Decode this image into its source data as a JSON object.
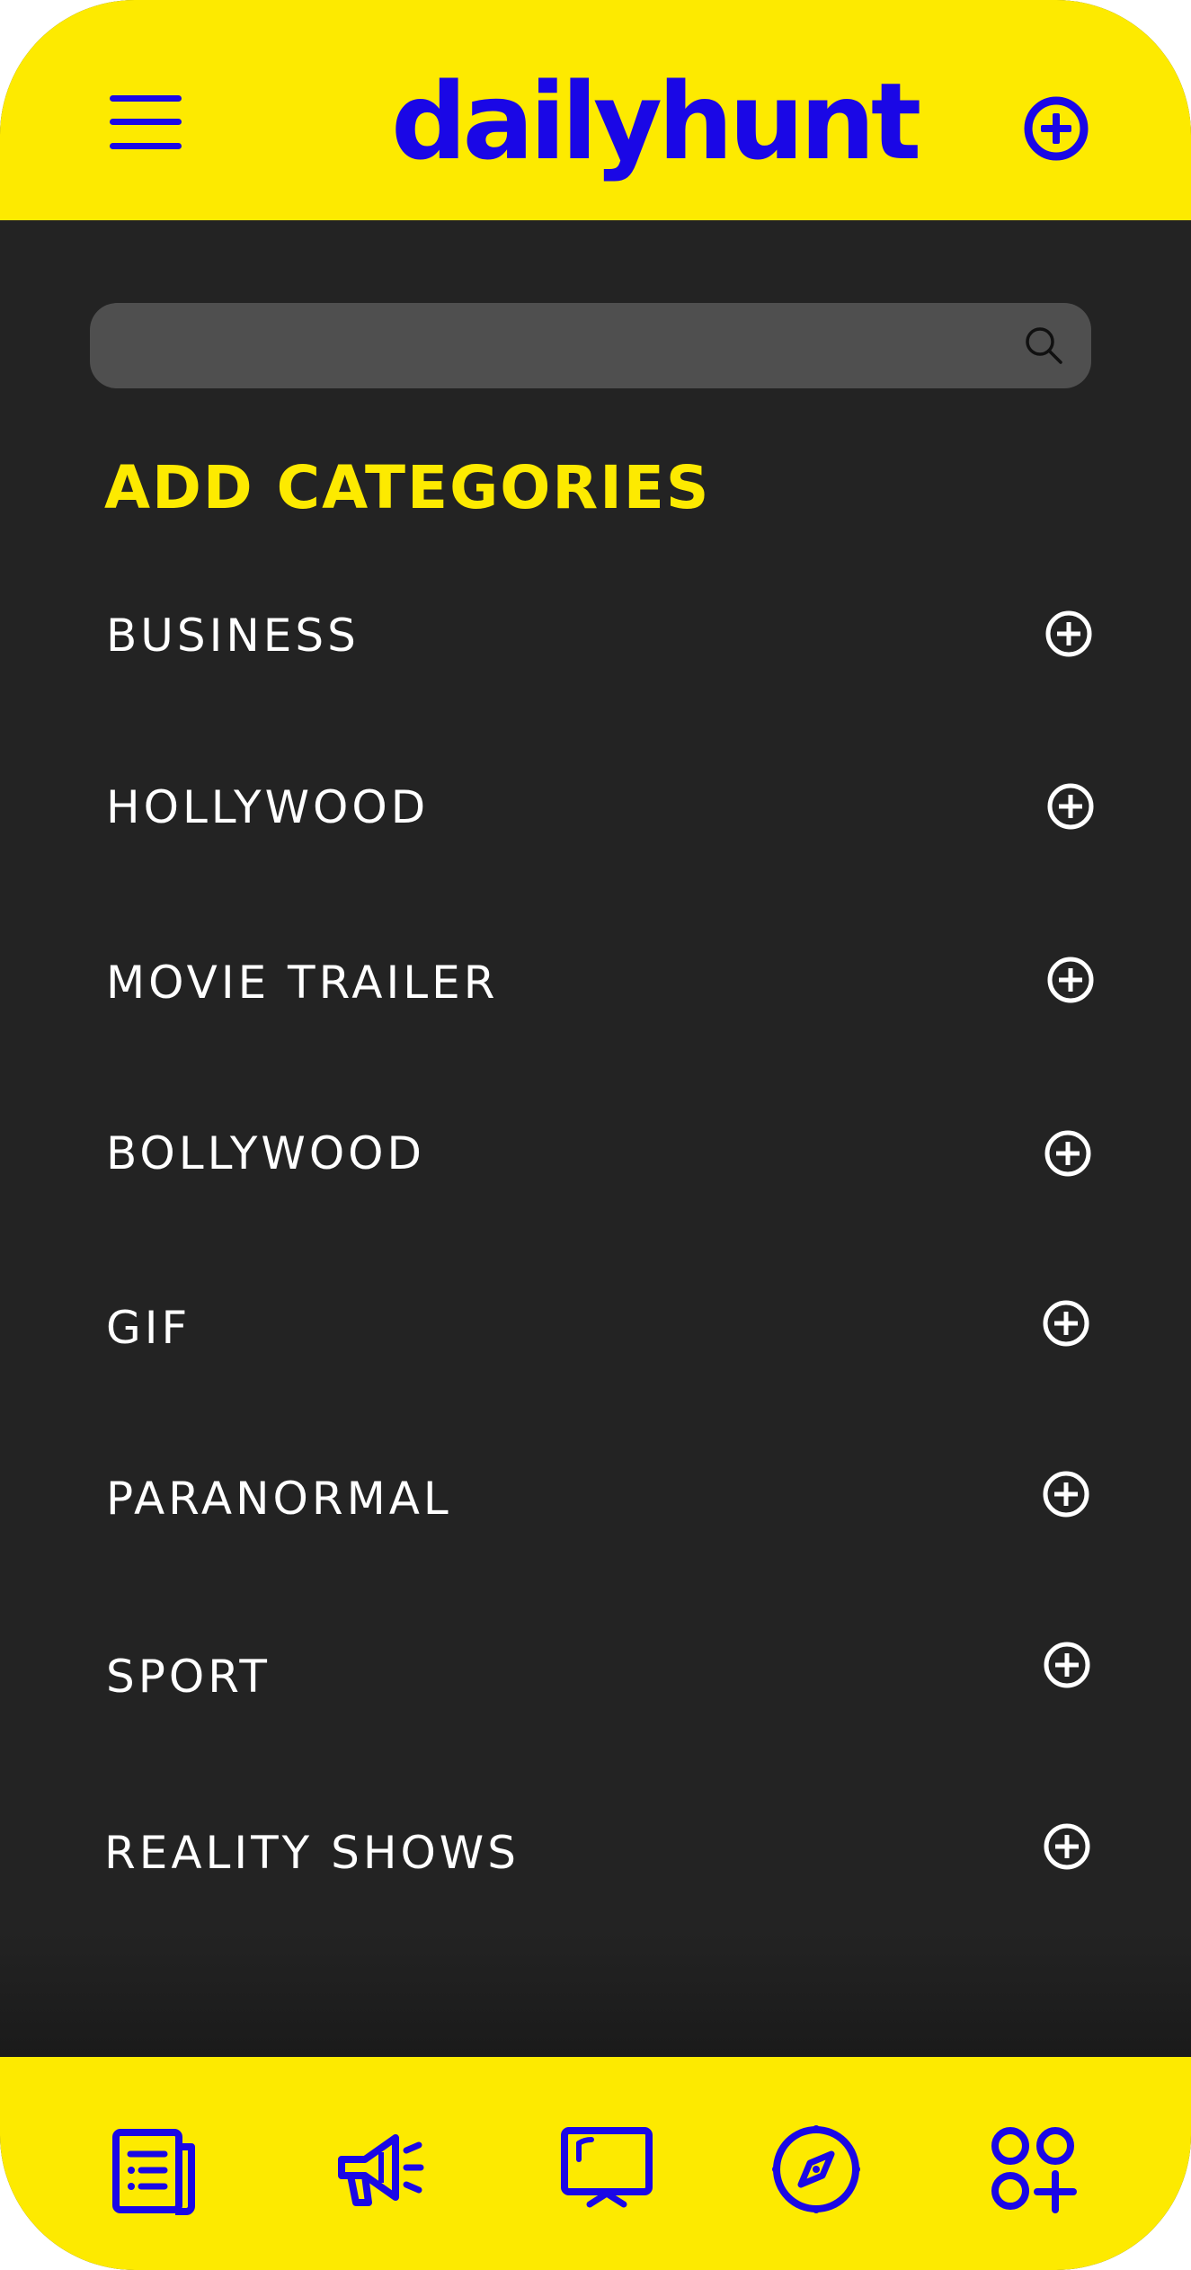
{
  "app": {
    "logo_text": "dailyhunt",
    "brand_color": "#fdea00",
    "accent_color": "#1a07e6"
  },
  "header": {
    "menu_icon": "hamburger-menu-icon",
    "add_icon": "plus-circle-icon"
  },
  "search": {
    "value": "",
    "placeholder": "",
    "icon": "search-icon"
  },
  "categories_section": {
    "title": "ADD CATEGORIES",
    "items": [
      {
        "label": "BUSINESS",
        "icon": "plus-circle-icon"
      },
      {
        "label": "HOLLYWOOD",
        "icon": "plus-circle-icon"
      },
      {
        "label": "MOVIE TRAILER",
        "icon": "plus-circle-icon"
      },
      {
        "label": "BOLLYWOOD",
        "icon": "plus-circle-icon"
      },
      {
        "label": "GIF",
        "icon": "plus-circle-icon"
      },
      {
        "label": "PARANORMAL",
        "icon": "plus-circle-icon"
      },
      {
        "label": "SPORT",
        "icon": "plus-circle-icon"
      },
      {
        "label": "REALITY SHOWS",
        "icon": "plus-circle-icon"
      }
    ]
  },
  "bottom_nav": {
    "items": [
      {
        "icon": "newspaper-icon"
      },
      {
        "icon": "megaphone-icon"
      },
      {
        "icon": "tv-icon"
      },
      {
        "icon": "compass-icon"
      },
      {
        "icon": "add-apps-icon"
      }
    ]
  }
}
